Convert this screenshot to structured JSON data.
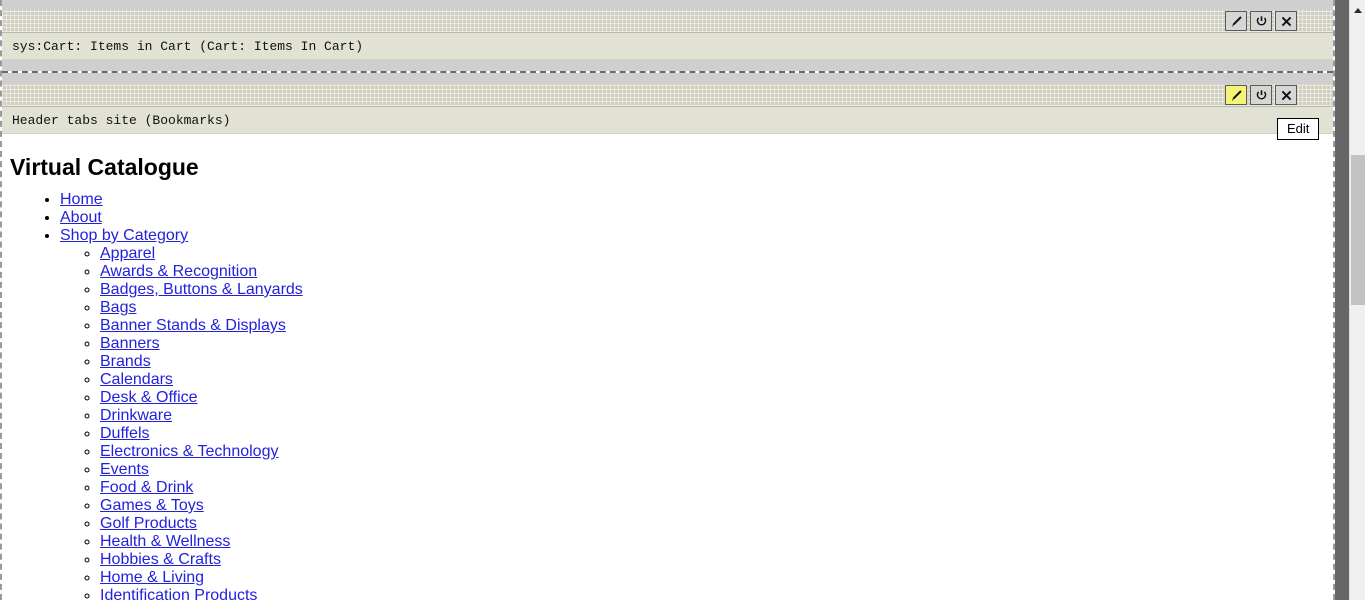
{
  "panels": [
    {
      "label": "sys:Cart: Items in Cart (Cart: Items In Cart)",
      "buttons": [
        {
          "name": "edit-button",
          "icon": "pencil-icon",
          "active": false
        },
        {
          "name": "power-button",
          "icon": "power-icon",
          "active": false
        },
        {
          "name": "close-button",
          "icon": "close-icon",
          "active": false
        }
      ]
    },
    {
      "label": "Header tabs site (Bookmarks)",
      "buttons": [
        {
          "name": "edit-button",
          "icon": "pencil-icon",
          "active": true
        },
        {
          "name": "power-button",
          "icon": "power-icon",
          "active": false
        },
        {
          "name": "close-button",
          "icon": "close-icon",
          "active": false
        }
      ]
    }
  ],
  "tooltip": {
    "text": "Edit"
  },
  "content": {
    "title": "Virtual Catalogue",
    "nav": [
      {
        "label": "Home"
      },
      {
        "label": "About"
      },
      {
        "label": "Shop by Category"
      }
    ],
    "categories": [
      "Apparel",
      "Awards & Recognition",
      "Badges, Buttons & Lanyards",
      "Bags",
      "Banner Stands & Displays",
      "Banners",
      "Brands",
      "Calendars",
      "Desk & Office",
      "Drinkware",
      "Duffels",
      "Electronics & Technology",
      "Events",
      "Food & Drink",
      "Games & Toys",
      "Golf Products",
      "Health & Wellness",
      "Hobbies & Crafts",
      "Home & Living",
      "Identification Products"
    ]
  },
  "colors": {
    "link": "#2222dd",
    "handle_bg": "#cfcec0",
    "label_bg": "#e2e2d4",
    "active_button": "#f4f479",
    "gutter": "#666666"
  },
  "scrollbar": {
    "name": "browser-vertical-scrollbar"
  }
}
